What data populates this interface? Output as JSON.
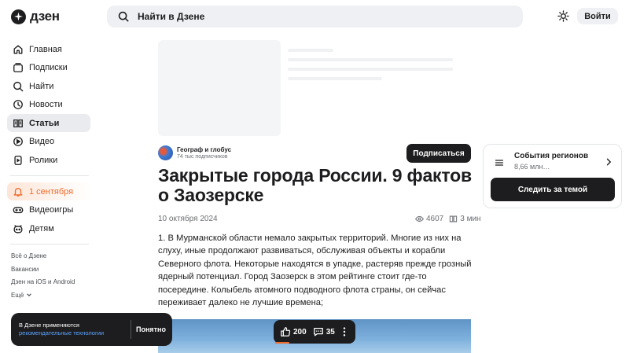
{
  "header": {
    "logo_text": "дзен",
    "search_placeholder": "Найти в Дзене",
    "login_label": "Войти"
  },
  "sidebar": {
    "items": [
      {
        "label": "Главная",
        "icon": "home-icon"
      },
      {
        "label": "Подписки",
        "icon": "subscriptions-icon"
      },
      {
        "label": "Найти",
        "icon": "search-icon"
      },
      {
        "label": "Новости",
        "icon": "news-icon"
      },
      {
        "label": "Статьи",
        "icon": "articles-icon",
        "active": true
      },
      {
        "label": "Видео",
        "icon": "video-icon"
      },
      {
        "label": "Ролики",
        "icon": "shorts-icon"
      }
    ],
    "promo_label": "1 сентября",
    "extra_items": [
      {
        "label": "Видеоигры",
        "icon": "gamepad-icon"
      },
      {
        "label": "Детям",
        "icon": "kids-icon"
      }
    ],
    "footer_links": [
      "Всё о Дзене",
      "Вакансии",
      "Дзен на iOS и Android",
      "Ещё"
    ]
  },
  "cookie": {
    "text": "В Дзене применяются",
    "link": "рекомендательные технологии",
    "ok_label": "Понятно"
  },
  "article": {
    "channel_name": "Географ и глобус",
    "channel_subscribers": "74 тыс подписчиков",
    "subscribe_label": "Подписаться",
    "title": "Закрытые города России. 9 фактов о Заозерске",
    "date": "10 октября 2024",
    "views": "4607",
    "read_time": "3 мин",
    "body": "1. В Мурманской области немало закрытых территорий. Многие из них на слуху, иные продолжают развиваться, обслуживая объекты и корабли Северного флота. Некоторые находятся в упадке, растеряв прежде грозный ядерный потенциал. Город Заозерск в этом рейтинге стоит где-то посередине. Колыбель атомного подводного флота страны, он сейчас переживает далеко не лучшие времена;"
  },
  "reactions": {
    "likes": "200",
    "comments": "35"
  },
  "widget": {
    "title": "События регионов",
    "subtitle": "8,66 млн…",
    "follow_label": "Следить за темой"
  },
  "colors": {
    "accent": "#f06a2c",
    "dark": "#1d1d1f",
    "link": "#5ba4ff",
    "surface": "#eef0f3"
  }
}
